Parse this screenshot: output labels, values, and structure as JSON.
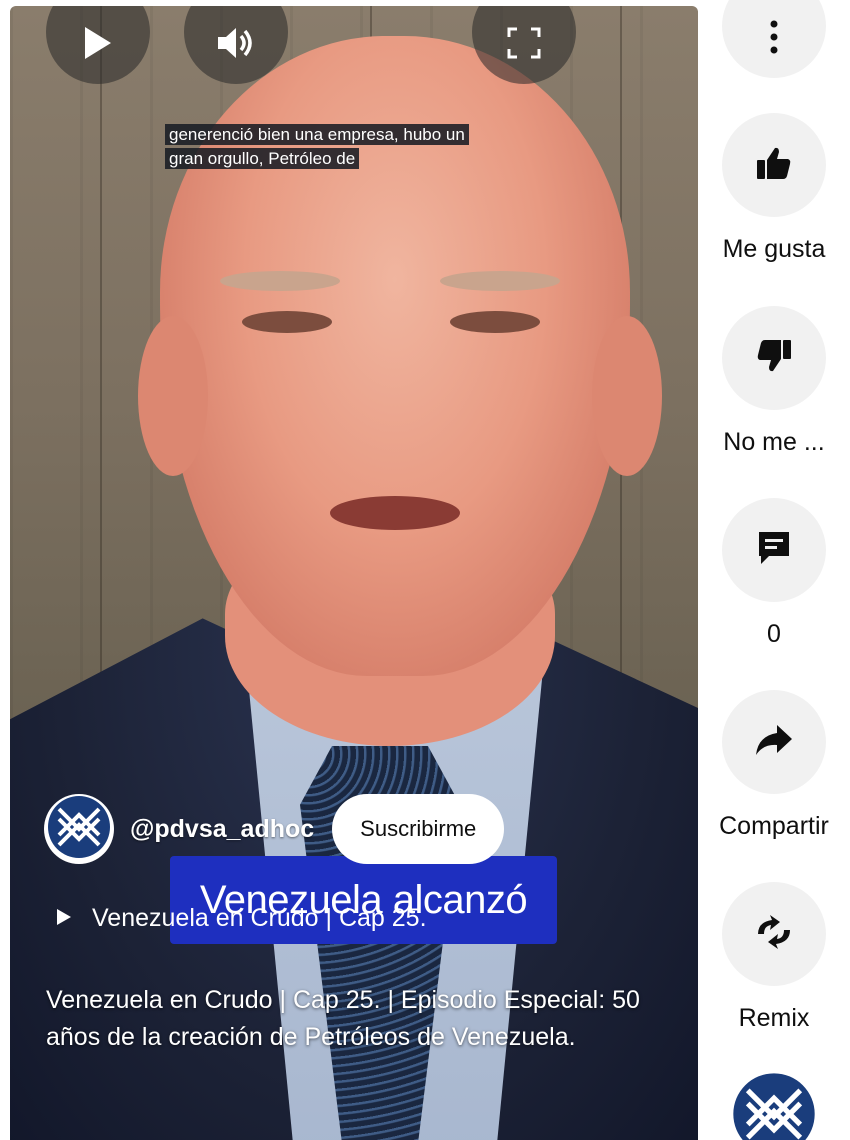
{
  "player": {
    "controls": {
      "play_icon": "play-icon",
      "volume_icon": "volume-icon",
      "fullscreen_icon": "fullscreen-icon"
    },
    "caption": {
      "line1": "generenció bien una empresa, hubo un",
      "line2": "gran orgullo, Petróleo de"
    }
  },
  "channel": {
    "handle": "@pdvsa_adhoc",
    "subscribe_label": "Suscribirme",
    "avatar_icon": "pdvsa-logo-icon"
  },
  "overlay": {
    "banner_text": "Venezuela alcanzó",
    "playlist_title": "Venezuela en Crudo | Cap 25."
  },
  "video": {
    "description": "Venezuela en Crudo | Cap 25. | Episodio Especial: 50 años de la creación de Petróleos de Venezuela."
  },
  "actions": {
    "more_icon": "more-vert-icon",
    "like_label": "Me gusta",
    "dislike_label": "No me ...",
    "comments_count": "0",
    "share_label": "Compartir",
    "remix_label": "Remix"
  },
  "colors": {
    "banner": "#1e2fbf",
    "logo_blue": "#1a3d7c",
    "action_bg": "#f1f1f1"
  }
}
